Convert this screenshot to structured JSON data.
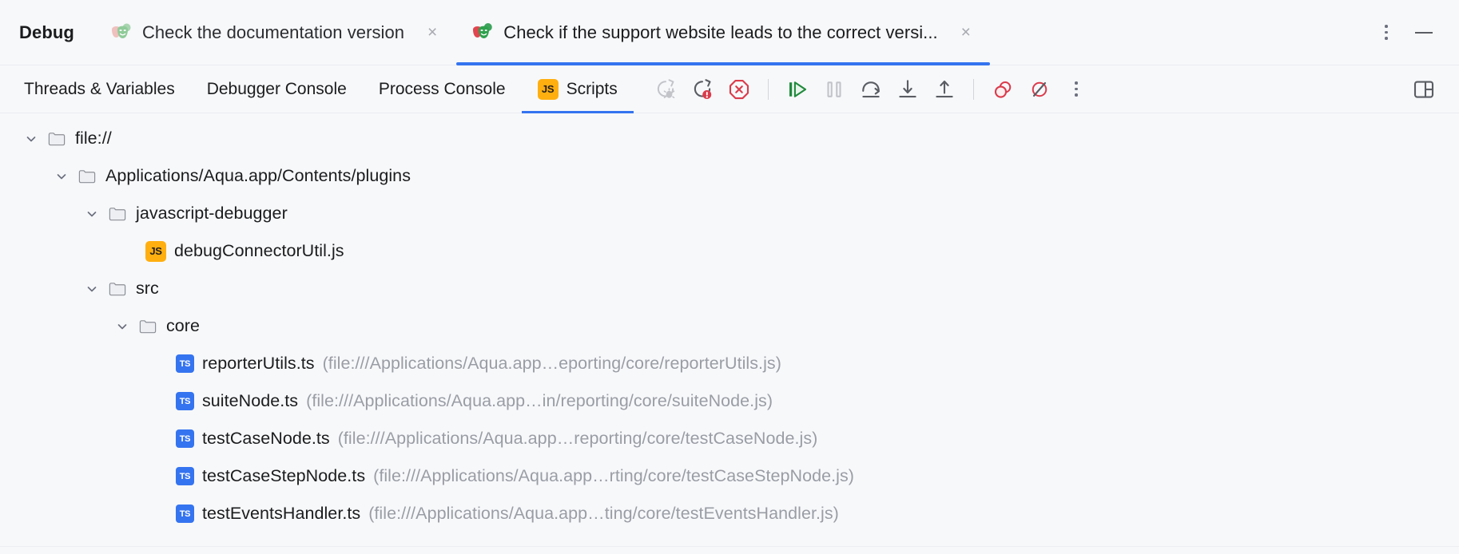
{
  "window": {
    "app_title": "Debug",
    "more_actions_label": "more-actions",
    "minimize_label": "minimize"
  },
  "tabs": [
    {
      "label": "Check the documentation version",
      "icon": "test-masks-icon",
      "active": false,
      "close_label": "×"
    },
    {
      "label": "Check if the support website leads to the correct versi...",
      "icon": "test-masks-icon",
      "active": true,
      "close_label": "×"
    }
  ],
  "view_tabs": [
    {
      "label": "Threads & Variables",
      "active": false,
      "icon": null
    },
    {
      "label": "Debugger Console",
      "active": false,
      "icon": null
    },
    {
      "label": "Process Console",
      "active": false,
      "icon": null
    },
    {
      "label": "Scripts",
      "active": true,
      "icon": "js-badge",
      "icon_text": "JS"
    }
  ],
  "toolbar_buttons": [
    {
      "name": "rerun-debug-button",
      "title": "Rerun",
      "state": "disabled"
    },
    {
      "name": "rerun-failed-tests-button",
      "title": "Rerun Failed Tests",
      "state": "enabled"
    },
    {
      "name": "stop-button",
      "title": "Stop",
      "state": "enabled"
    },
    {
      "name": "separator-1",
      "title": "",
      "state": "separator"
    },
    {
      "name": "resume-program-button",
      "title": "Resume Program",
      "state": "enabled"
    },
    {
      "name": "pause-program-button",
      "title": "Pause Program",
      "state": "disabled"
    },
    {
      "name": "step-over-button",
      "title": "Step Over",
      "state": "enabled"
    },
    {
      "name": "step-into-button",
      "title": "Step Into",
      "state": "enabled"
    },
    {
      "name": "step-out-button",
      "title": "Step Out",
      "state": "enabled"
    },
    {
      "name": "separator-2",
      "title": "",
      "state": "separator"
    },
    {
      "name": "view-breakpoints-button",
      "title": "View Breakpoints",
      "state": "enabled"
    },
    {
      "name": "mute-breakpoints-button",
      "title": "Mute Breakpoints",
      "state": "enabled"
    },
    {
      "name": "toolbar-more-button",
      "title": "More",
      "state": "enabled"
    }
  ],
  "toolbar_right": {
    "layout_settings_label": "layout-settings"
  },
  "tree": {
    "rows": [
      {
        "depth": 0,
        "expanded": true,
        "icon": "folder",
        "name": "file://",
        "path": ""
      },
      {
        "depth": 1,
        "expanded": true,
        "icon": "folder",
        "name": "Applications/Aqua.app/Contents/plugins",
        "path": ""
      },
      {
        "depth": 2,
        "expanded": true,
        "icon": "folder",
        "name": "javascript-debugger",
        "path": ""
      },
      {
        "depth": 3,
        "expanded": null,
        "icon": "js",
        "name": "debugConnectorUtil.js",
        "path": ""
      },
      {
        "depth": 2,
        "expanded": true,
        "icon": "folder",
        "name": "src",
        "path": ""
      },
      {
        "depth": 3,
        "expanded": true,
        "icon": "folder",
        "name": "core",
        "path": ""
      },
      {
        "depth": 4,
        "expanded": null,
        "icon": "ts",
        "name": "reporterUtils.ts",
        "path": "(file:///Applications/Aqua.app…eporting/core/reporterUtils.js)"
      },
      {
        "depth": 4,
        "expanded": null,
        "icon": "ts",
        "name": "suiteNode.ts",
        "path": "(file:///Applications/Aqua.app…in/reporting/core/suiteNode.js)"
      },
      {
        "depth": 4,
        "expanded": null,
        "icon": "ts",
        "name": "testCaseNode.ts",
        "path": "(file:///Applications/Aqua.app…reporting/core/testCaseNode.js)"
      },
      {
        "depth": 4,
        "expanded": null,
        "icon": "ts",
        "name": "testCaseStepNode.ts",
        "path": "(file:///Applications/Aqua.app…rting/core/testCaseStepNode.js)"
      },
      {
        "depth": 4,
        "expanded": null,
        "icon": "ts",
        "name": "testEventsHandler.ts",
        "path": "(file:///Applications/Aqua.app…ting/core/testEventsHandler.js)"
      }
    ]
  },
  "colors": {
    "background": "#F7F8FA",
    "accent_blue": "#3574F0",
    "text": "#1B1C1E",
    "muted_text": "#9A9DA5",
    "js_badge": "#FFAF0F",
    "ts_badge": "#3574F0",
    "danger_red": "#DB3B4B",
    "success_green": "#208A3C"
  }
}
